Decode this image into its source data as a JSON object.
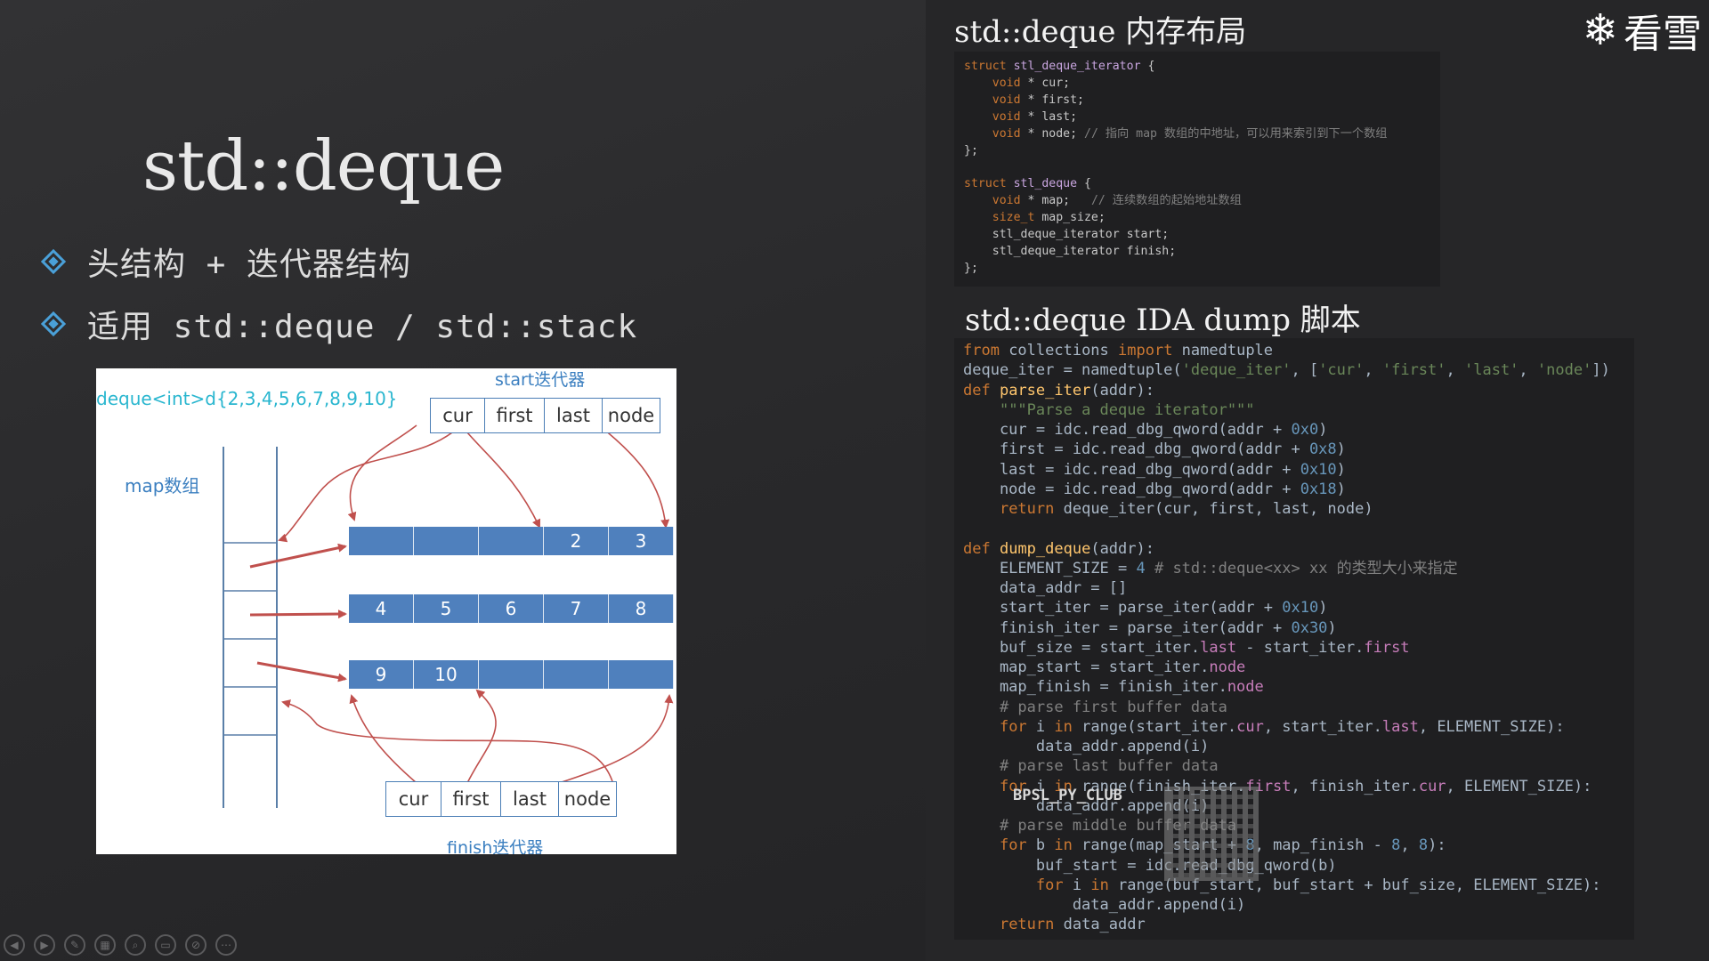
{
  "slide": {
    "title": "std::deque",
    "bullets": [
      "头结构 + 迭代器结构",
      "适用 std::deque / std::stack"
    ]
  },
  "diagram": {
    "decl": "deque<int>d{2,3,4,5,6,7,8,9,10}",
    "map_label": "map数组",
    "start_label": "start迭代器",
    "finish_label": "finish迭代器",
    "iterator_fields": [
      "cur",
      "first",
      "last",
      "node"
    ],
    "buffers": [
      [
        "",
        "",
        "",
        "2",
        "3"
      ],
      [
        "4",
        "5",
        "6",
        "7",
        "8"
      ],
      [
        "9",
        "10",
        "",
        "",
        ""
      ]
    ]
  },
  "right": {
    "title1": "std::deque 内存布局",
    "title2": "std::deque IDA dump 脚本",
    "watermark": "看雪",
    "overlay_text": "BPSL_PY_CLUB"
  },
  "colors": {
    "accent": "#4aa0d8",
    "buffer": "#4f80bd",
    "arrow": "#c0504d",
    "label_blue": "#3b7fc0",
    "decl_cyan": "#29b6cf"
  },
  "toolbar_icons": [
    "prev-icon",
    "next-icon",
    "pen-icon",
    "slides-icon",
    "zoom-icon",
    "subtitle-icon",
    "screen-off-icon",
    "more-icon"
  ]
}
